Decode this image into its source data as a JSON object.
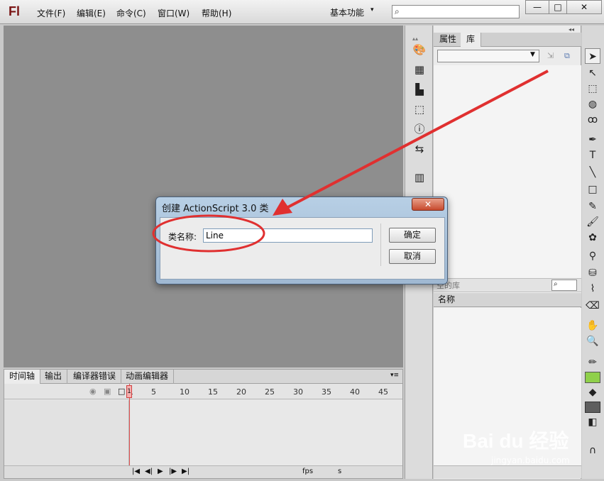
{
  "app": {
    "logo": "Fl"
  },
  "menu": [
    {
      "label": "文件(F)"
    },
    {
      "label": "编辑(E)"
    },
    {
      "label": "命令(C)"
    },
    {
      "label": "窗口(W)"
    },
    {
      "label": "帮助(H)"
    }
  ],
  "workspace": {
    "label": "基本功能",
    "arrow": "▾"
  },
  "search": {
    "value": "",
    "icon": "search-icon"
  },
  "window_controls": {
    "minimize": "—",
    "maximize": "□",
    "close": "✕"
  },
  "timeline": {
    "tabs": [
      "时间轴",
      "输出",
      "编译器错误",
      "动画编辑器"
    ],
    "ticks": [
      "1",
      "5",
      "10",
      "15",
      "20",
      "25",
      "30",
      "35",
      "40",
      "45"
    ],
    "fps": "fps",
    "seconds": "s"
  },
  "panel": {
    "tabs": [
      "属性",
      "库"
    ],
    "lib_count": "空的库",
    "name_header": "名称"
  },
  "dialog": {
    "title": "创建 ActionScript 3.0 类",
    "close": "✕",
    "label": "类名称:",
    "input_value": "Line",
    "ok": "确定",
    "cancel": "取消"
  },
  "annotation_color": "#e03030",
  "watermark": {
    "brand": "Bai du 经验",
    "url": "jingyan.baidu.com"
  }
}
